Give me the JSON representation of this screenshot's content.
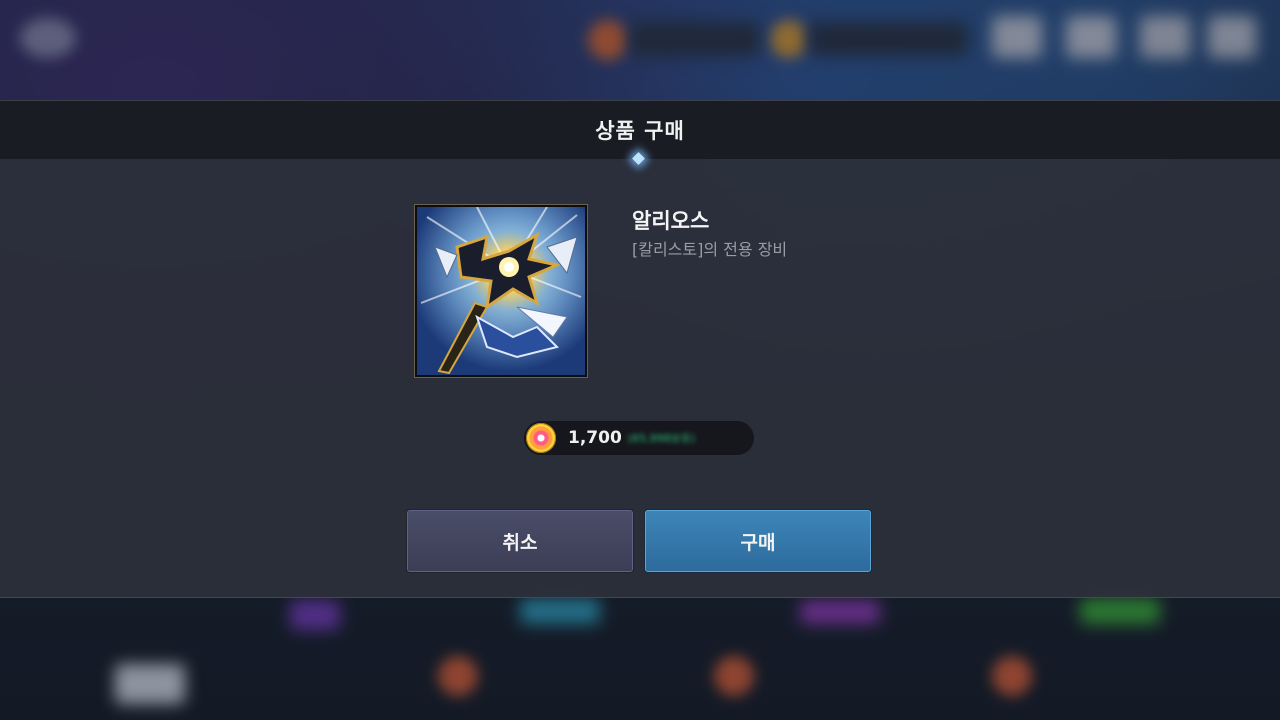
{
  "dialog": {
    "title": "상품 구매",
    "item": {
      "name": "알리오스",
      "description": "[칼리스토]의 전용 장비",
      "icon": "weapon-icon"
    },
    "price": {
      "currency_icon": "gem-currency-icon",
      "value": "1,700",
      "balance": "(65,998보유)"
    },
    "buttons": {
      "cancel": "취소",
      "buy": "구매"
    }
  },
  "colors": {
    "header_bg": "#18191f",
    "panel_bg": "#2c2f3a",
    "cancel_button": "#454862",
    "buy_button": "#3479ab",
    "balance_text": "#2fcf8a"
  }
}
